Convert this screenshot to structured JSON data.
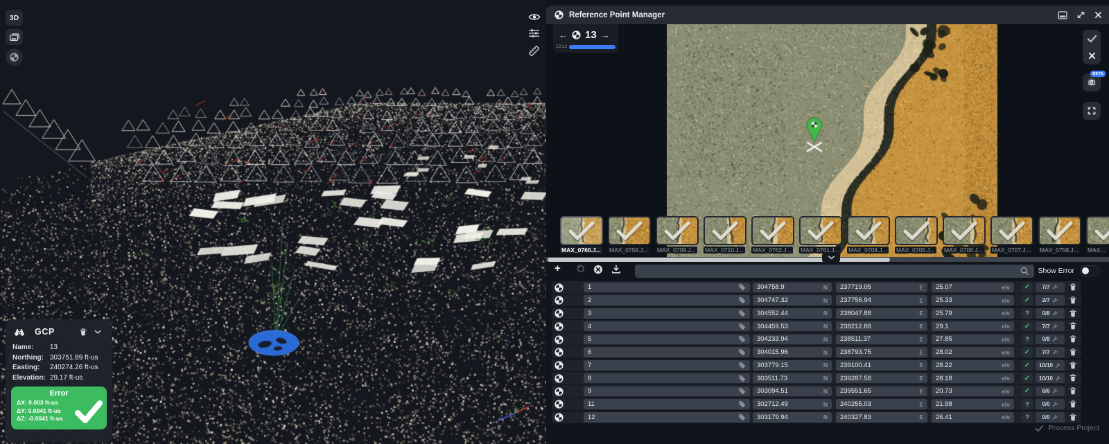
{
  "left": {
    "view_3d": "3D",
    "gcp_card": {
      "title": "GCP",
      "fields": [
        {
          "label": "Name:",
          "value": "13"
        },
        {
          "label": "Northing:",
          "value": "303751.89 ft-us"
        },
        {
          "label": "Easting:",
          "value": "240274.26 ft-us"
        },
        {
          "label": "Elevation:",
          "value": "29.17 ft-us"
        }
      ],
      "error": {
        "title": "Error",
        "lines": [
          "ΔX: 0.003 ft-us",
          "ΔY: 0.0041 ft-us",
          "ΔZ: -0.0041 ft-us"
        ]
      }
    }
  },
  "panel": {
    "title": "Reference Point Manager",
    "nav": {
      "current": "13",
      "progress": "12/12",
      "progress_percent": 100
    },
    "side_buttons": {
      "beta_label": "BETA"
    },
    "thumbnails": [
      {
        "label": "MAX_0760.J...",
        "selected": true
      },
      {
        "label": "MAX_0759.J...",
        "selected": false
      },
      {
        "label": "MAX_0709.J...",
        "selected": false
      },
      {
        "label": "MAX_0710.J...",
        "selected": false
      },
      {
        "label": "MAX_0762.J...",
        "selected": false
      },
      {
        "label": "MAX_0761.J...",
        "selected": false
      },
      {
        "label": "MAX_0708.J...",
        "selected": false
      },
      {
        "label": "MAX_0705.J...",
        "selected": false
      },
      {
        "label": "MAX_0706.J...",
        "selected": false
      },
      {
        "label": "MAX_0707.J...",
        "selected": false
      },
      {
        "label": "MAX_0758.J...",
        "selected": false
      },
      {
        "label": "MAX...",
        "selected": false
      }
    ],
    "toolbar": {
      "search_value": "",
      "show_error_label": "Show Error",
      "show_error_on": false
    },
    "table": {
      "units": {
        "northing": "N",
        "easting": "E",
        "elevation": "elv"
      },
      "rows": [
        {
          "name": "1",
          "northing": "304758.9",
          "easting": "237719.05",
          "elevation": "25.07",
          "status": "check",
          "count": "7/7"
        },
        {
          "name": "2",
          "northing": "304747.32",
          "easting": "237756.94",
          "elevation": "25.33",
          "status": "check",
          "count": "2/7"
        },
        {
          "name": "3",
          "northing": "304552.44",
          "easting": "238047.88",
          "elevation": "25.79",
          "status": "question",
          "count": "0/8"
        },
        {
          "name": "4",
          "northing": "304459.53",
          "easting": "238212.88",
          "elevation": "29.1",
          "status": "check",
          "count": "7/7"
        },
        {
          "name": "5",
          "northing": "304233.94",
          "easting": "238511.37",
          "elevation": "27.85",
          "status": "question",
          "count": "0/8"
        },
        {
          "name": "6",
          "northing": "304015.96",
          "easting": "238793.75",
          "elevation": "28.02",
          "status": "check",
          "count": "7/7"
        },
        {
          "name": "7",
          "northing": "303779.15",
          "easting": "239100.41",
          "elevation": "28.22",
          "status": "check",
          "count": "10/10"
        },
        {
          "name": "8",
          "northing": "303511.73",
          "easting": "239287.58",
          "elevation": "28.18",
          "status": "check",
          "count": "10/10"
        },
        {
          "name": "9",
          "northing": "303094.51",
          "easting": "239551.65",
          "elevation": "20.73",
          "status": "check",
          "count": "6/6"
        },
        {
          "name": "11",
          "northing": "302712.49",
          "easting": "240255.03",
          "elevation": "21.98",
          "status": "question",
          "count": "0/0"
        },
        {
          "name": "12",
          "northing": "303179.94",
          "easting": "240327.83",
          "elevation": "26.41",
          "status": "question",
          "count": "0/0"
        }
      ]
    },
    "footer": {
      "process_label": "Process Project"
    }
  },
  "colors": {
    "accent_blue": "#3e7bfa",
    "success_green": "#3ec965",
    "error_box_green": "#3dbb60"
  }
}
